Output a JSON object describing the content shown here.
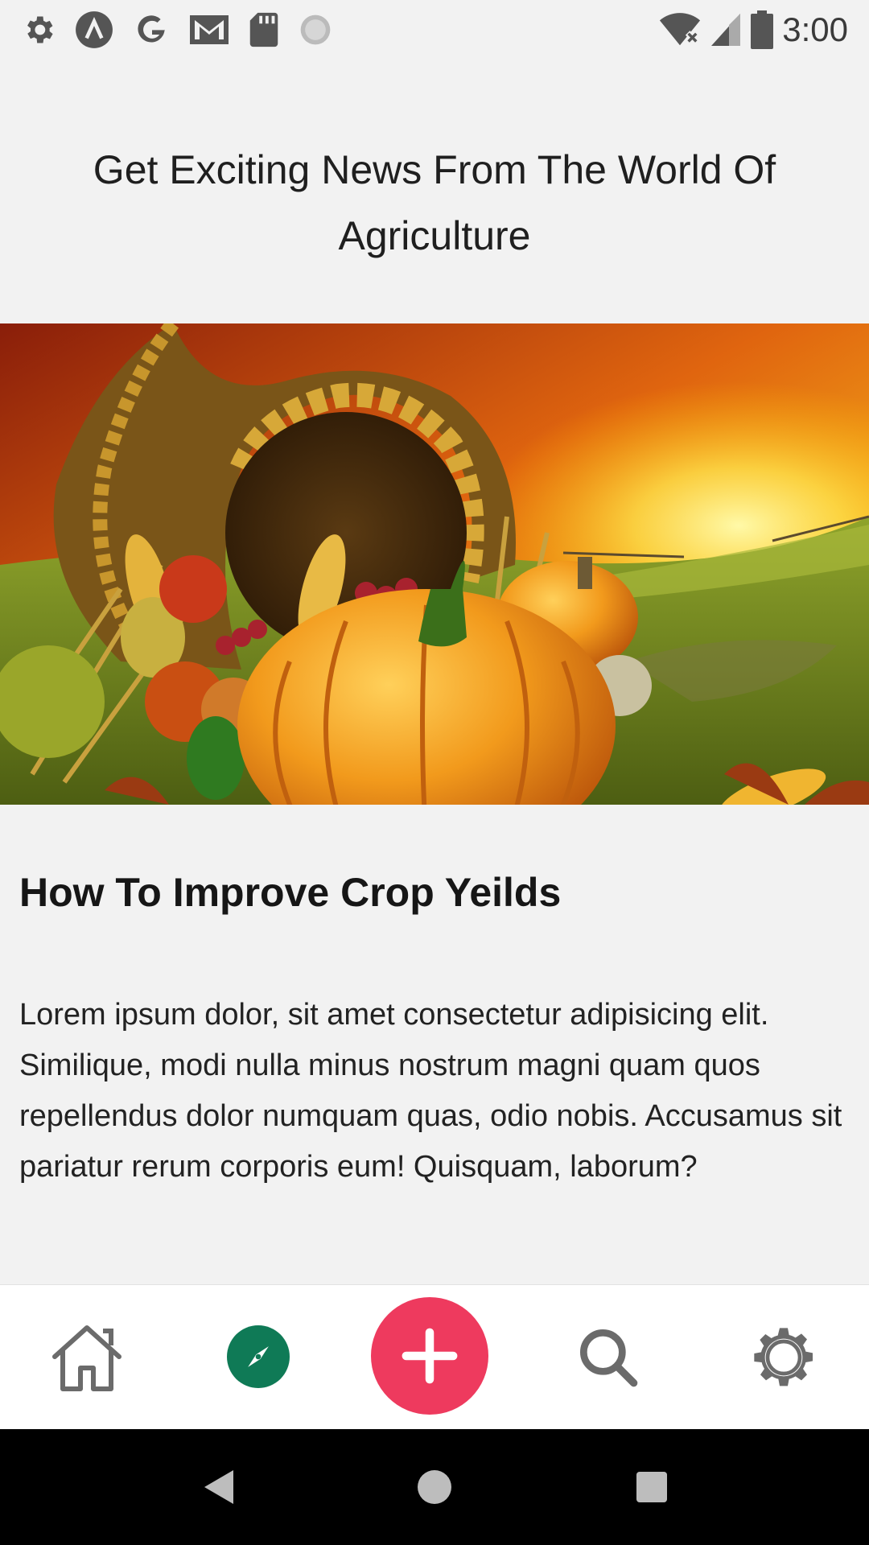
{
  "status_bar": {
    "time": "3:00",
    "left_icons": [
      "settings-icon",
      "app-a-icon",
      "google-icon",
      "gmail-icon",
      "sd-card-icon",
      "loading-icon"
    ],
    "right_icons": [
      "wifi-off-icon",
      "signal-icon",
      "battery-icon"
    ]
  },
  "page": {
    "title": "Get Exciting News From The World Of Agriculture"
  },
  "hero": {
    "icon": "harvest-cornucopia-image"
  },
  "article": {
    "title": "How To Improve Crop Yeilds",
    "body": "Lorem ipsum dolor, sit amet consectetur adipisicing elit. Similique, modi nulla minus nostrum magni quam quos repellendus dolor numquam quas, odio nobis. Accusamus sit pariatur rerum corporis eum! Quisquam, laborum?"
  },
  "tab_bar": {
    "tabs": [
      {
        "name": "home",
        "icon": "home-icon"
      },
      {
        "name": "explore",
        "icon": "compass-icon",
        "active": true
      },
      {
        "name": "add",
        "icon": "plus-icon"
      },
      {
        "name": "search",
        "icon": "search-icon"
      },
      {
        "name": "settings",
        "icon": "gear-icon"
      }
    ],
    "colors": {
      "explore": "#0f7a56",
      "add": "#ee3a5e",
      "inactive": "#6b6b6b"
    }
  },
  "nav_bar": {
    "buttons": [
      "back",
      "home",
      "recents"
    ]
  }
}
